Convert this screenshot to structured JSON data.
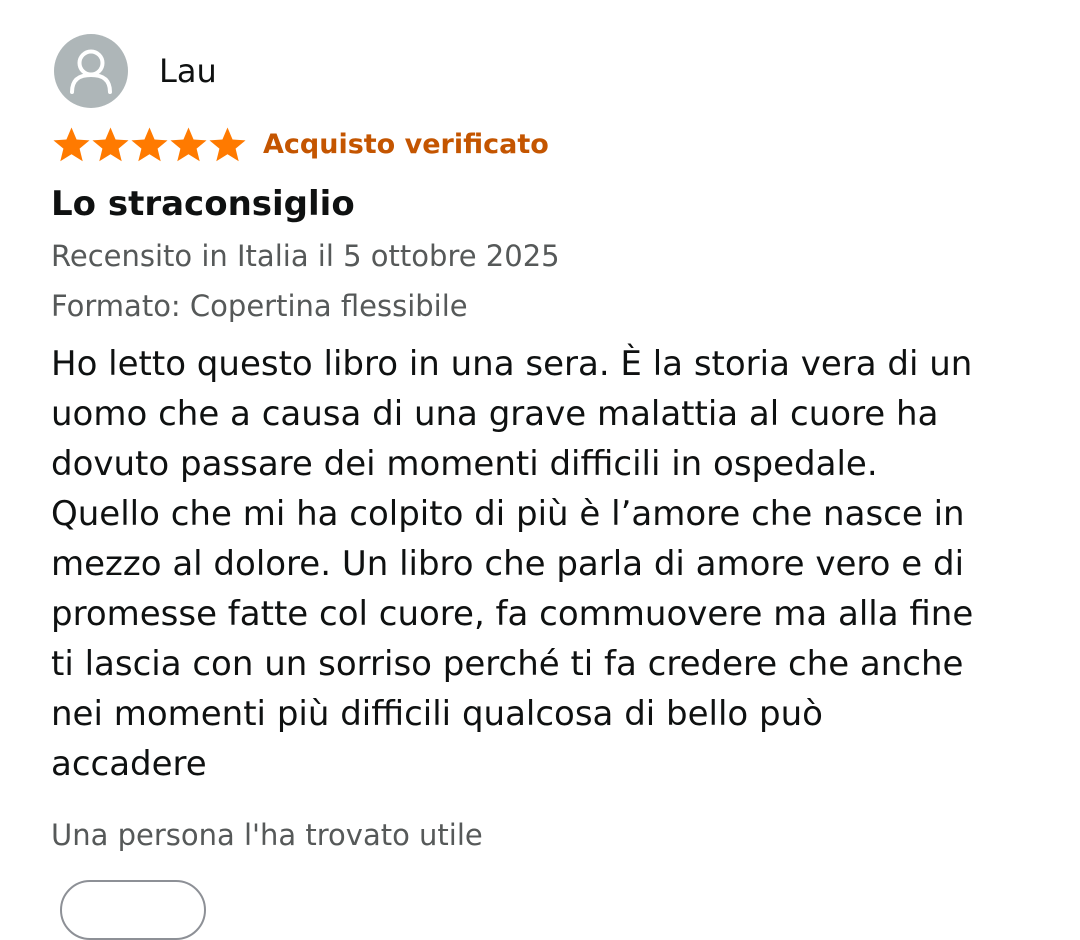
{
  "author": {
    "name": "Lau",
    "avatar_icon": "person-icon"
  },
  "rating": {
    "value": 5,
    "max": 5,
    "star_color": "#ff7a00",
    "verified_label": "Acquisto verificato",
    "verified_color": "#c45500"
  },
  "review": {
    "title": "Lo straconsiglio",
    "date_text": "Recensito in Italia il 5 ottobre 2025",
    "format_text": "Formato: Copertina flessibile",
    "body_lines": [
      "Ho letto questo libro in una sera. È la storia vera di un",
      "uomo che a causa di una grave malattia al cuore ha",
      "dovuto passare dei momenti difficili in ospedale.",
      "Quello che mi ha colpito di più è l’amore che nasce in",
      "mezzo al dolore. Un libro che parla di amore vero e di",
      "promesse fatte col cuore, fa commuovere ma alla fine",
      "ti lascia con un sorriso perché ti fa credere che anche",
      "nei momenti più difficili qualcosa di bello può",
      "accadere"
    ],
    "helpful_text": "Una persona l'ha trovato utile"
  }
}
